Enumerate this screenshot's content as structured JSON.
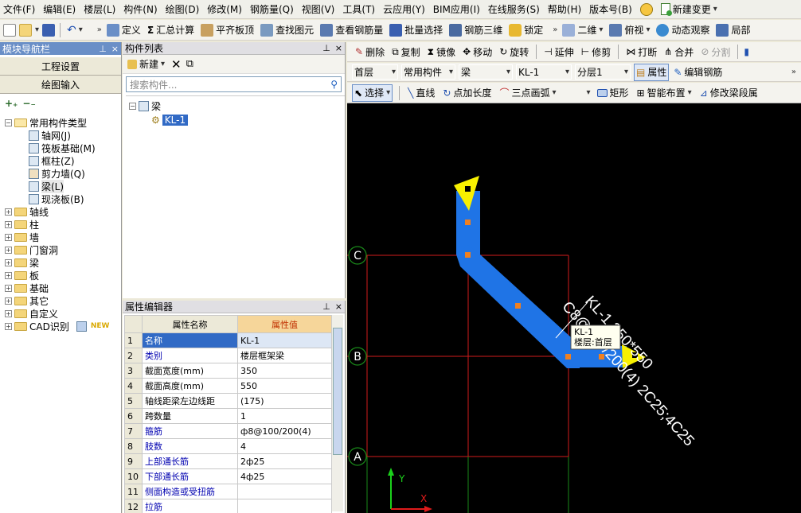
{
  "menu": [
    "文件(F)",
    "编辑(E)",
    "楼层(L)",
    "构件(N)",
    "绘图(D)",
    "修改(M)",
    "钢筋量(Q)",
    "视图(V)",
    "工具(T)",
    "云应用(Y)",
    "BIM应用(I)",
    "在线服务(S)",
    "帮助(H)",
    "版本号(B)"
  ],
  "menu_extra": {
    "new_change": "新建变更"
  },
  "toolbar": {
    "define": "定义",
    "summary_calc": "汇总计算",
    "align_slab_top": "平齐板顶",
    "find_element": "查找图元",
    "view_rebar_qty": "查看钢筋量",
    "batch_select": "批量选择",
    "rebar_3d": "钢筋三维",
    "lock": "锁定",
    "view_2d": "二维",
    "top_view": "俯视",
    "dynamic_orbit": "动态观察",
    "local": "局部"
  },
  "nav": {
    "title": "模块导航栏",
    "project_settings": "工程设置",
    "drawing_input": "绘图输入",
    "tree": {
      "common_types": "常用构件类型",
      "common_items": [
        "轴网(J)",
        "筏板基础(M)",
        "框柱(Z)",
        "剪力墙(Q)",
        "梁(L)",
        "现浇板(B)"
      ],
      "folders": [
        "轴线",
        "柱",
        "墙",
        "门窗洞",
        "梁",
        "板",
        "基础",
        "其它",
        "自定义",
        "CAD识别"
      ],
      "new_badge": "NEW"
    }
  },
  "component_list": {
    "title": "构件列表",
    "new_label": "新建",
    "search_placeholder": "搜索构件...",
    "tree": {
      "root": "梁",
      "items": [
        "KL-1"
      ]
    }
  },
  "properties": {
    "title": "属性编辑器",
    "headers": [
      "属性名称",
      "属性值"
    ],
    "rows": [
      {
        "no": "1",
        "name": "名称",
        "value": "KL-1"
      },
      {
        "no": "2",
        "name": "类别",
        "value": "楼层框架梁"
      },
      {
        "no": "3",
        "name": "截面宽度(mm)",
        "value": "350"
      },
      {
        "no": "4",
        "name": "截面高度(mm)",
        "value": "550"
      },
      {
        "no": "5",
        "name": "轴线距梁左边线距",
        "value": "(175)"
      },
      {
        "no": "6",
        "name": "跨数量",
        "value": "1"
      },
      {
        "no": "7",
        "name": "箍筋",
        "value": "ф8@100/200(4)"
      },
      {
        "no": "8",
        "name": "肢数",
        "value": "4"
      },
      {
        "no": "9",
        "name": "上部通长筋",
        "value": "2ф25"
      },
      {
        "no": "10",
        "name": "下部通长筋",
        "value": "4ф25"
      },
      {
        "no": "11",
        "name": "侧面构造或受扭筋",
        "value": ""
      },
      {
        "no": "12",
        "name": "拉筋",
        "value": ""
      }
    ]
  },
  "edit_toolbar": [
    "删除",
    "复制",
    "镜像",
    "移动",
    "旋转",
    "延伸",
    "修剪",
    "打断",
    "合并",
    "分割"
  ],
  "selectors": {
    "floor": "首层",
    "component_type": "常用构件",
    "component": "梁",
    "element": "KL-1",
    "sublayer": "分层1",
    "properties_btn": "属性",
    "edit_rebar_btn": "编辑钢筋"
  },
  "draw_toolbar": {
    "select": "选择",
    "line": "直线",
    "point_length": "点加长度",
    "three_point_arc": "三点画弧",
    "rectangle": "矩形",
    "smart_layout": "智能布置",
    "modify_beam_segment": "修改梁段属"
  },
  "canvas": {
    "axis_labels": [
      "C",
      "B",
      "A"
    ],
    "annotation": [
      "KL-1 350*550",
      "C8@100/200(4) 2C25;4C25"
    ],
    "tooltip": [
      "KL-1",
      "楼层:首层"
    ],
    "ucs": {
      "x": "X",
      "y": "Y"
    }
  }
}
